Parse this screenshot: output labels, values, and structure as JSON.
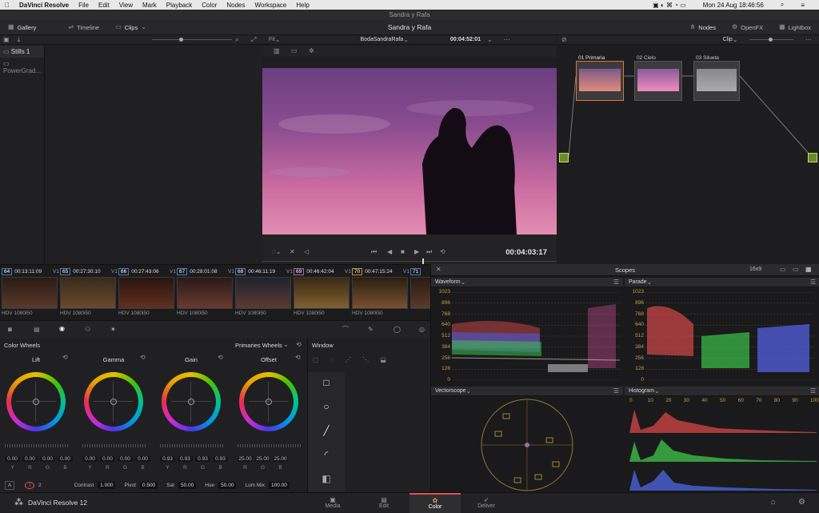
{
  "macbar": {
    "apple": "",
    "app": "DaVinci Resolve",
    "menus": [
      "File",
      "Edit",
      "View",
      "Mark",
      "Playback",
      "Color",
      "Nodes",
      "Workspace",
      "Help"
    ],
    "datetime": "Mon 24 Aug  18:46:56"
  },
  "window_title": "Sandra y Rafa",
  "toolbar": {
    "gallery": "Gallery",
    "timeline": "Timeline",
    "clips": "Clips",
    "project": "Sandra y Rafa",
    "nodes": "Nodes",
    "openfx": "OpenFX",
    "lightbox": "Lightbox"
  },
  "viewer": {
    "fit": "Fit",
    "clip_name": "BodaSandraRafa",
    "timecode_top": "00:04:52:01",
    "timecode": "00:04:03:17",
    "node_mode": "Clip"
  },
  "gallery": {
    "stills": "Stills 1",
    "powergrade": "PowerGrad..."
  },
  "nodes": [
    {
      "num": "01",
      "name": "Primaria"
    },
    {
      "num": "02",
      "name": "Cielo"
    },
    {
      "num": "03",
      "name": "Silueta"
    }
  ],
  "clips": [
    {
      "num": "64",
      "tc": "00:13:11:09",
      "track": "V1",
      "codec": "HDV 1080i50",
      "color": "#3a7fb0"
    },
    {
      "num": "65",
      "tc": "00:27:30:10",
      "track": "V1",
      "codec": "HDV 1080i50",
      "color": "#3a7fb0"
    },
    {
      "num": "66",
      "tc": "00:27:43:06",
      "track": "V1",
      "codec": "HDV 1080i50",
      "color": "#3a7fb0"
    },
    {
      "num": "67",
      "tc": "00:28:01:08",
      "track": "V1",
      "codec": "HDV 1080i50",
      "color": "#3a7fb0"
    },
    {
      "num": "68",
      "tc": "00:46:11:19",
      "track": "V1",
      "codec": "HDV 1080i50",
      "color": "#3a7fb0"
    },
    {
      "num": "69",
      "tc": "00:46:42:04",
      "track": "V1",
      "codec": "HDV 1080i50",
      "color": "#b35fb0"
    },
    {
      "num": "70",
      "tc": "00:47:15:24",
      "track": "V1",
      "codec": "HDV 1080i50",
      "color": "#d18b2a"
    },
    {
      "num": "71",
      "tc": "",
      "track": "",
      "codec": "",
      "color": "#3a7fb0"
    }
  ],
  "color_wheels": {
    "title": "Color Wheels",
    "mode": "Primaries Wheels",
    "wheels": [
      {
        "name": "Lift",
        "values": [
          "0.00",
          "0.00",
          "0.00",
          "0.00"
        ]
      },
      {
        "name": "Gamma",
        "values": [
          "0.00",
          "0.00",
          "0.00",
          "0.00"
        ]
      },
      {
        "name": "Gain",
        "values": [
          "0.93",
          "0.93",
          "0.93",
          "0.93"
        ]
      },
      {
        "name": "Offset",
        "values": [
          "25.00",
          "25.00",
          "25.00"
        ]
      }
    ],
    "labels4": [
      "Y",
      "R",
      "G",
      "B"
    ],
    "labels3": [
      "R",
      "G",
      "B"
    ],
    "bottom": {
      "a": "A",
      "p1": "1",
      "p2": "2",
      "contrast_label": "Contrast",
      "contrast": "1.000",
      "pivot_label": "Pivot",
      "pivot": "0.500",
      "sat_label": "Sat",
      "sat": "50.00",
      "hue_label": "Hue",
      "hue": "50.00",
      "lummix_label": "Lum Mix",
      "lummix": "100.00"
    }
  },
  "window_panel": {
    "title": "Window"
  },
  "scopes": {
    "title": "Scopes",
    "layout": "16x9",
    "waveform": "Waveform",
    "parade": "Parade",
    "vectorscope": "Vectorscope",
    "histogram": "Histogram",
    "scale": [
      "1023",
      "896",
      "768",
      "640",
      "512",
      "384",
      "256",
      "128",
      "0"
    ],
    "hist_scale": [
      "0",
      "10",
      "20",
      "30",
      "40",
      "50",
      "60",
      "70",
      "80",
      "90",
      "100"
    ]
  },
  "bottombar": {
    "brand": "DaVinci Resolve 12",
    "tabs": [
      "Media",
      "Edit",
      "Color",
      "Deliver"
    ],
    "active": "Color"
  }
}
